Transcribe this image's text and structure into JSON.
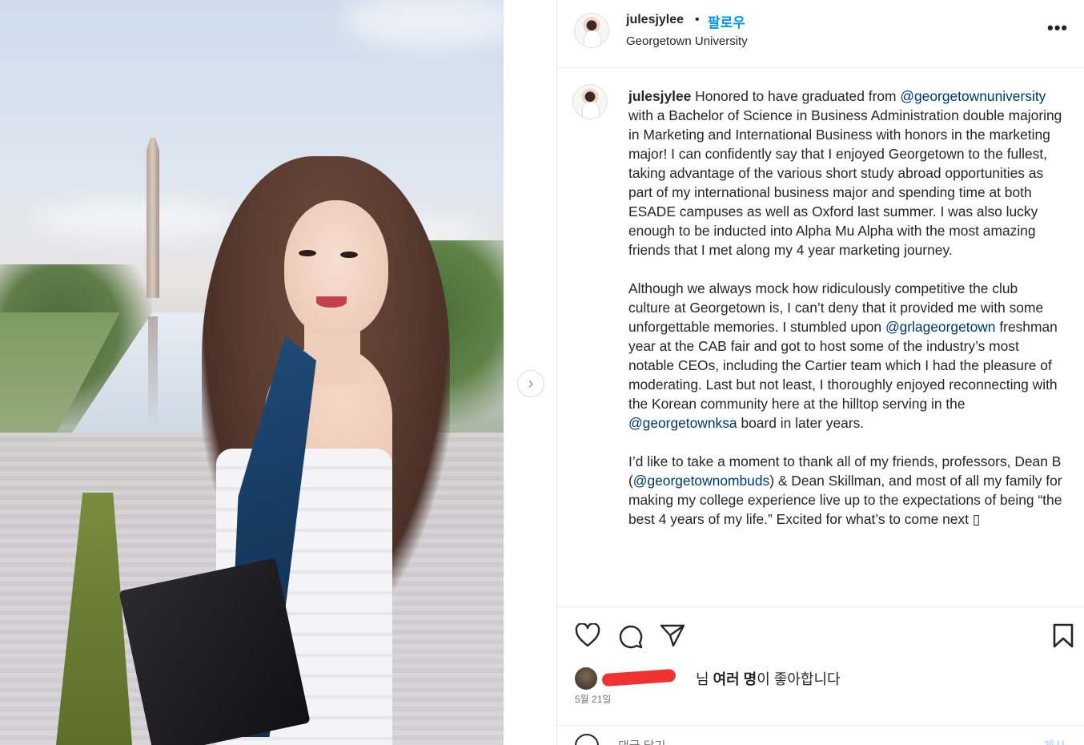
{
  "post": {
    "username": "julesjylee",
    "separator": "•",
    "follow_label": "팔로우",
    "location": "Georgetown University",
    "more_label": "•••"
  },
  "caption": {
    "username": "julesjylee",
    "p1_a": "Honored to have graduated from ",
    "p1_mention": "@georgetownuniversity",
    "p1_b": " with a Bachelor of Science in Business Administration double majoring in Marketing and International Business with honors in the marketing major! I can confidently say that I enjoyed Georgetown to the fullest, taking advantage of the various short study abroad opportunities as part of my international business major and spending time at both ESADE campuses as well as Oxford last summer. I was also lucky enough to be inducted into Alpha Mu Alpha with the most amazing friends that I met along my 4 year marketing journey.",
    "p2_a": "Although we always mock how ridiculously competitive the club culture at Georgetown is, I can’t deny that it provided me with some unforgettable memories. I stumbled upon ",
    "p2_mention1": "@grlageorgetown",
    "p2_b": " freshman year at the CAB fair and got to host some of the industry’s most notable CEOs, including the Cartier team which I had the pleasure of moderating. Last but not least, I thoroughly enjoyed reconnecting with the Korean community here at the hilltop serving in the ",
    "p2_mention2": "@georgetownksa",
    "p2_c": " board in later years.",
    "p3_a": "I’d like to take a moment to thank all of my friends, professors, Dean B (",
    "p3_mention": "@georgetownombuds",
    "p3_b": ") & Dean Skillman, and most of all my family for making my college experience live up to the expectations of being “the best 4 years of my life.” Excited for what’s to come next ",
    "p3_emoji": "▯"
  },
  "likes": {
    "suffix_a": "님 ",
    "bold": "여러 명",
    "suffix_b": "이 좋아합니다"
  },
  "date": "5월 21일",
  "comment": {
    "placeholder": "댓글 달기...",
    "post_label": "게시"
  },
  "icons": {
    "next": "chevron-right-icon",
    "like": "heart-icon",
    "comment": "comment-icon",
    "share": "paper-plane-icon",
    "save": "bookmark-icon"
  }
}
